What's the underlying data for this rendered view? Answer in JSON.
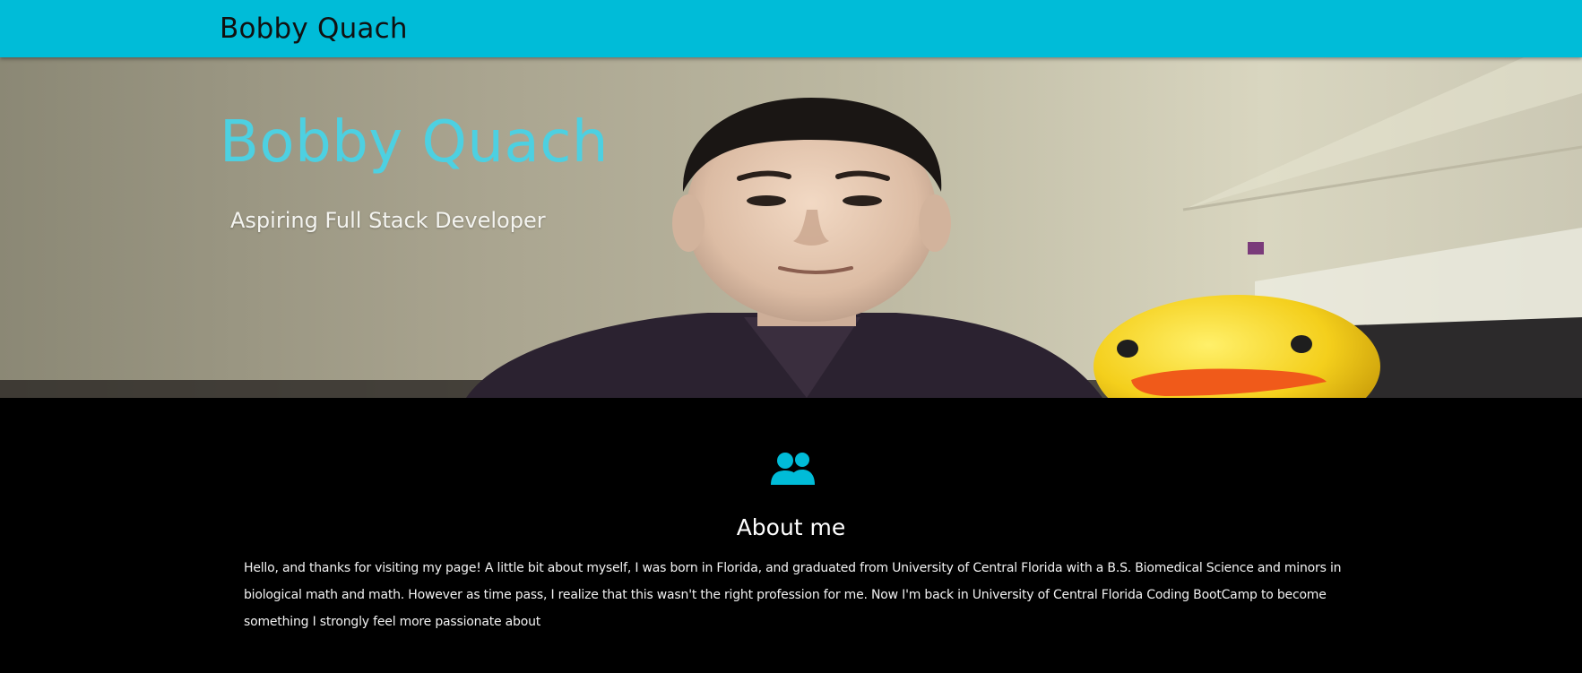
{
  "navbar": {
    "brand": "Bobby Quach",
    "background_color": "#00bcd8"
  },
  "hero": {
    "title": "Bobby Quach",
    "subtitle": "Aspiring Full Stack Developer",
    "title_color": "#4dd0e1",
    "image_description": "photo-of-person-with-rubber-duck"
  },
  "about": {
    "icon": "people-icon",
    "icon_color": "#00bcd8",
    "heading": "About me",
    "body": "Hello, and thanks for visiting my page! A little bit about myself, I was born in Florida, and graduated from University of Central Florida with a B.S. Biomedical Science and minors in biological math and math. However as time pass, I realize that this wasn't the right profession for me. Now I'm back in University of Central Florida Coding BootCamp to become something I strongly feel more passionate about"
  }
}
